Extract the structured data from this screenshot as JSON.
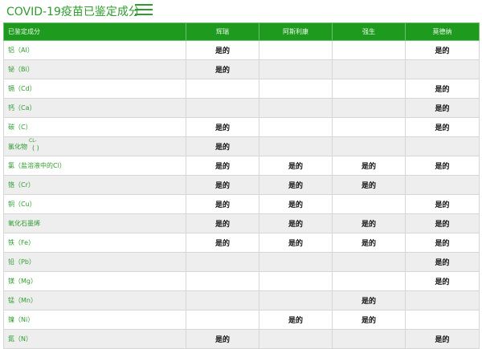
{
  "header": {
    "title": "COVID-19疫苗已鉴定成分",
    "menu_icon": "hamburger-menu-icon"
  },
  "table": {
    "columns": [
      "已鉴定成分",
      "辉瑞",
      "阿斯利康",
      "强生",
      "莫德纳"
    ],
    "rows": [
      {
        "name": "铝（Al）",
        "values": [
          "是的",
          "",
          "",
          "是的"
        ]
      },
      {
        "name": "铋（Bi）",
        "values": [
          "是的",
          "",
          "",
          ""
        ]
      },
      {
        "name": "镉（Cd）",
        "values": [
          "",
          "",
          "",
          "是的"
        ]
      },
      {
        "name": "钙（Ca）",
        "values": [
          "",
          "",
          "",
          "是的"
        ]
      },
      {
        "name": "碳（C）",
        "values": [
          "是的",
          "",
          "",
          "是的"
        ]
      },
      {
        "name": "氯化物",
        "sup_top": "CL-",
        "sup_bottom": "( )",
        "values": [
          "是的",
          "",
          "",
          ""
        ]
      },
      {
        "name": "氯（盐溶液中的Cl）",
        "values": [
          "是的",
          "是的",
          "是的",
          "是的"
        ]
      },
      {
        "name": "铬（Cr）",
        "values": [
          "是的",
          "是的",
          "是的",
          ""
        ]
      },
      {
        "name": "铜（Cu）",
        "values": [
          "是的",
          "是的",
          "",
          "是的"
        ]
      },
      {
        "name": "氧化石墨烯",
        "values": [
          "是的",
          "是的",
          "是的",
          "是的"
        ]
      },
      {
        "name": "铁（Fe）",
        "values": [
          "是的",
          "是的",
          "是的",
          "是的"
        ]
      },
      {
        "name": "铅（Pb）",
        "values": [
          "",
          "",
          "",
          "是的"
        ]
      },
      {
        "name": "镁（Mg）",
        "values": [
          "",
          "",
          "",
          "是的"
        ]
      },
      {
        "name": "锰（Mn）",
        "values": [
          "",
          "",
          "是的",
          ""
        ]
      },
      {
        "name": "镍（Ni）",
        "values": [
          "",
          "是的",
          "是的",
          ""
        ]
      },
      {
        "name": "氮（N）",
        "values": [
          "是的",
          "",
          "",
          "是的"
        ]
      }
    ]
  }
}
